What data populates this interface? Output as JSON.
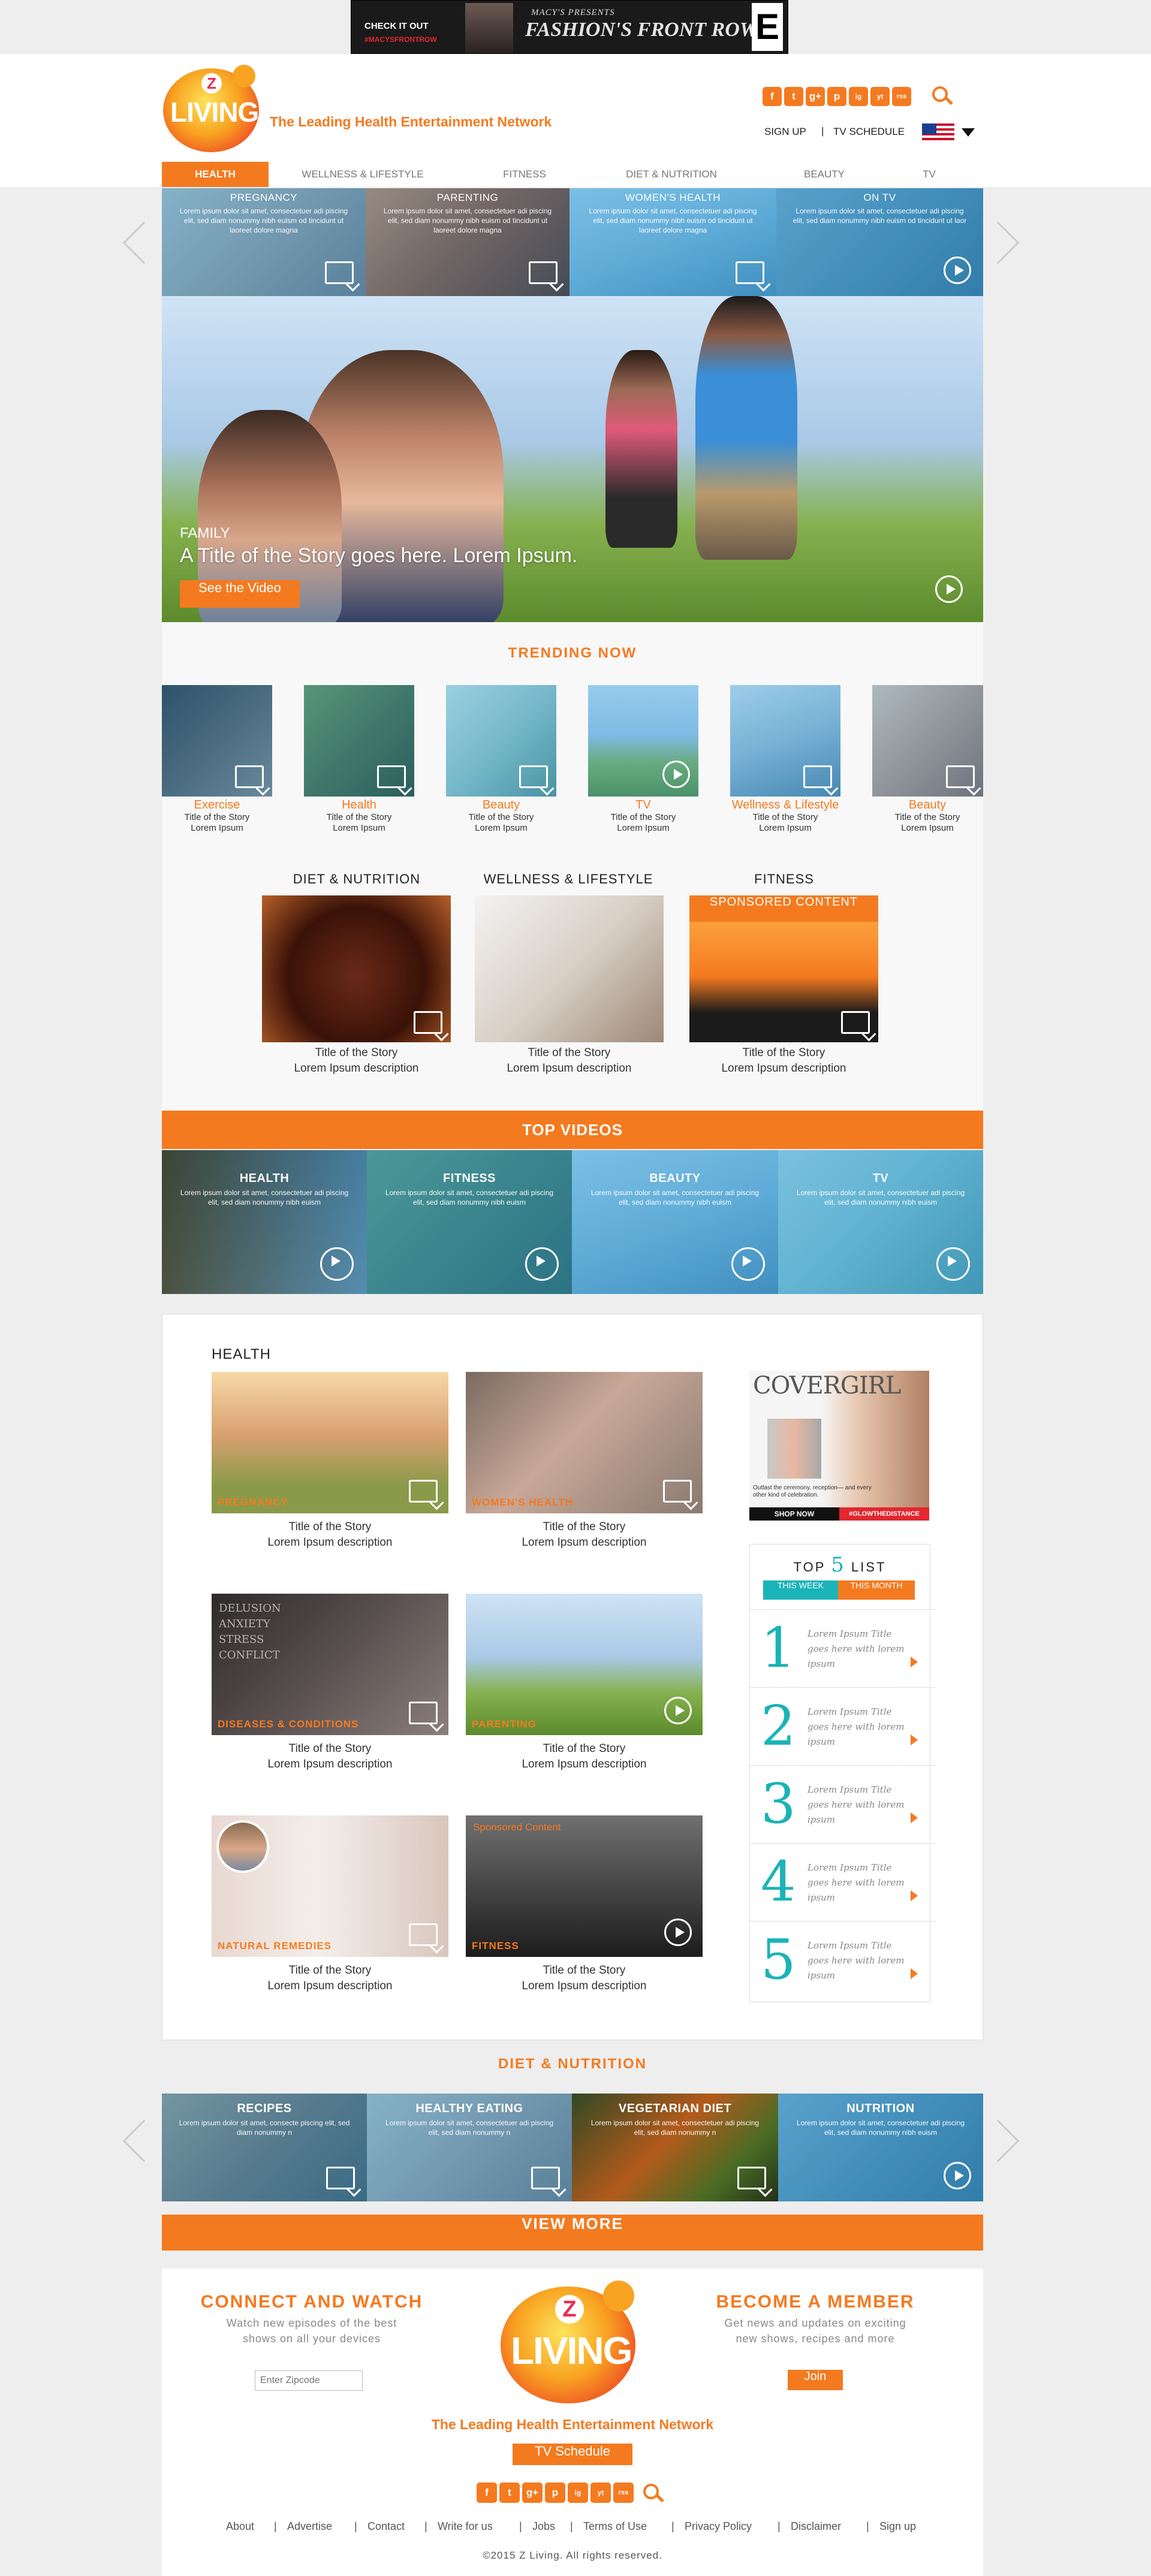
{
  "banner": {
    "check_it_out": "CHECK IT OUT",
    "hashtag": "#MACYSFRONTROW",
    "presenter": "MACY'S PRESENTS",
    "headline": "FASHION'S FRONT ROW",
    "badge": "E"
  },
  "header": {
    "logo_z": "Z",
    "logo_living": "LIVING",
    "tagline": "The Leading Health Entertainment Network",
    "sign_up": "SIGN UP",
    "divider": "|",
    "tv_schedule": "TV SCHEDULE"
  },
  "social": [
    "f",
    "t",
    "g+",
    "p",
    "ig",
    "yt",
    "rss"
  ],
  "nav": [
    "HEALTH",
    "WELLNESS & LIFESTYLE",
    "FITNESS",
    "DIET & NUTRITION",
    "BEAUTY",
    "TV"
  ],
  "hero_tabs": [
    {
      "title": "PREGNANCY",
      "text": "Lorem ipsum dolor sit amet, consectetuer adi piscing elit, sed diam nonummy nibh euism od tincidunt ut laoreet dolore magna"
    },
    {
      "title": "PARENTING",
      "text": "Lorem ipsum dolor sit amet, consectetuer adi piscing elit, sed diam nonummy nibh euism od tincidunt ut laoreet dolore magna"
    },
    {
      "title": "WOMEN'S HEALTH",
      "text": "Lorem ipsum dolor sit amet, consectetuer adi piscing elit, sed diam nonummy nibh euism od tincidunt ut laoreet dolore magna"
    },
    {
      "title": "ON TV",
      "text": "Lorem ipsum dolor sit amet, consectetuer adi piscing elit, sed diam nonummy nibh euism od tincidunt ut laor"
    }
  ],
  "hero": {
    "category": "FAMILY",
    "title": "A Title of the Story goes here. Lorem Ipsum.",
    "cta": "See the Video"
  },
  "trending": {
    "title": "TRENDING NOW",
    "items": [
      {
        "cat": "Exercise",
        "t1": "Title of the Story",
        "t2": "Lorem Ipsum"
      },
      {
        "cat": "Health",
        "t1": "Title of the Story",
        "t2": "Lorem Ipsum"
      },
      {
        "cat": "Beauty",
        "t1": "Title of the Story",
        "t2": "Lorem Ipsum"
      },
      {
        "cat": "TV",
        "t1": "Title of the Story",
        "t2": "Lorem Ipsum"
      },
      {
        "cat": "Wellness & Lifestyle",
        "t1": "Title of the Story",
        "t2": "Lorem Ipsum"
      },
      {
        "cat": "Beauty",
        "t1": "Title of the Story",
        "t2": "Lorem Ipsum"
      }
    ]
  },
  "features": [
    {
      "heading": "DIET & NUTRITION",
      "t1": "Title of the Story",
      "t2": "Lorem Ipsum description"
    },
    {
      "heading": "WELLNESS & LIFESTYLE",
      "t1": "Title of the Story",
      "t2": "Lorem Ipsum description"
    },
    {
      "heading": "FITNESS",
      "badge": "SPONSORED CONTENT",
      "t1": "Title of the Story",
      "t2": "Lorem Ipsum description"
    }
  ],
  "top_videos": {
    "title": "TOP VIDEOS",
    "items": [
      {
        "title": "HEALTH",
        "text": "Lorem ipsum dolor sit amet, consectetuer adi piscing elit, sed diam nonummy nibh euism"
      },
      {
        "title": "FITNESS",
        "text": "Lorem ipsum dolor sit amet, consectetuer adi piscing elit, sed diam nonummy nibh euism"
      },
      {
        "title": "BEAUTY",
        "text": "Lorem ipsum dolor sit amet, consectetuer adi piscing elit, sed diam nonummy nibh euism"
      },
      {
        "title": "TV",
        "text": "Lorem ipsum dolor sit amet, consectetuer adi piscing elit, sed diam nonummy nibh euism"
      }
    ]
  },
  "health": {
    "title": "HEALTH",
    "cards": [
      {
        "label": "PREGNANCY",
        "t1": "Title of the Story",
        "t2": "Lorem Ipsum description"
      },
      {
        "label": "WOMEN'S HEALTH",
        "t1": "Title of the Story",
        "t2": "Lorem Ipsum description"
      },
      {
        "label": "DISEASES & CONDITIONS",
        "t1": "Title of the Story",
        "t2": "Lorem Ipsum description",
        "words": "DELUSION ANXIETY STRESS CONFLICT"
      },
      {
        "label": "PARENTING",
        "t1": "Title of the Story",
        "t2": "Lorem Ipsum description"
      },
      {
        "label": "NATURAL REMEDIES",
        "t1": "Title of the Story",
        "t2": "Lorem Ipsum description"
      },
      {
        "label": "FITNESS",
        "sponsored": "Sponsored Content",
        "t1": "Title of the Story",
        "t2": "Lorem Ipsum description"
      }
    ]
  },
  "ad": {
    "brand": "COVERGIRL",
    "copy": "Outlast the ceremony, reception— and every other kind of celebration.",
    "shop": "SHOP NOW",
    "hashtag": "#GLOWTHEDISTANCE"
  },
  "top5": {
    "top": "TOP",
    "five": "5",
    "list": "LIST",
    "tab_week": "THIS WEEK",
    "tab_month": "THIS MONTH",
    "items": [
      {
        "num": "1",
        "text": "Lorem Ipsum Title goes here with lorem ipsum"
      },
      {
        "num": "2",
        "text": "Lorem Ipsum Title goes here with lorem ipsum"
      },
      {
        "num": "3",
        "text": "Lorem Ipsum Title goes here with lorem ipsum"
      },
      {
        "num": "4",
        "text": "Lorem Ipsum Title goes here with lorem ipsum"
      },
      {
        "num": "5",
        "text": "Lorem Ipsum Title goes here with lorem ipsum"
      }
    ]
  },
  "diet": {
    "title": "DIET & NUTRITION",
    "items": [
      {
        "title": "RECIPES",
        "text": "Lorem ipsum dolor sit amet, consecte piscing elit, sed diam nonummy n"
      },
      {
        "title": "HEALTHY EATING",
        "text": "Lorem ipsum dolor sit amet, consectetuer adi piscing elit, sed diam nonummy n"
      },
      {
        "title": "VEGETARIAN DIET",
        "text": "Lorem ipsum dolor sit amet, consectetuer adi piscing elit, sed diam nonummy n"
      },
      {
        "title": "NUTRITION",
        "text": "Lorem ipsum dolor sit amet, consectetuer adi piscing elit, sed diam nonummy nibh euism"
      }
    ]
  },
  "view_more": "VIEW MORE",
  "footer": {
    "connect_title": "CONNECT AND WATCH",
    "connect_text1": "Watch new episodes of the best",
    "connect_text2": "shows on all your devices",
    "zip_placeholder": "Enter Zipcode",
    "member_title": "BECOME A MEMBER",
    "member_text1": "Get news and updates on exciting",
    "member_text2": "new shows, recipes and more",
    "join": "Join",
    "logo_z": "Z",
    "logo_living": "LIVING",
    "tagline": "The Leading Health Entertainment Network",
    "tv_schedule": "TV Schedule",
    "links": [
      "About",
      "Advertise",
      "Contact",
      "Write for us",
      "Jobs",
      "Terms of Use",
      "Privacy Policy",
      "Disclaimer",
      "Sign up"
    ],
    "sep": "|",
    "copyright": "©2015 Z Living. All rights reserved."
  },
  "colors": {
    "accent": "#f47a20",
    "teal": "#1ab3b8",
    "tint": "#2ea0dc"
  }
}
